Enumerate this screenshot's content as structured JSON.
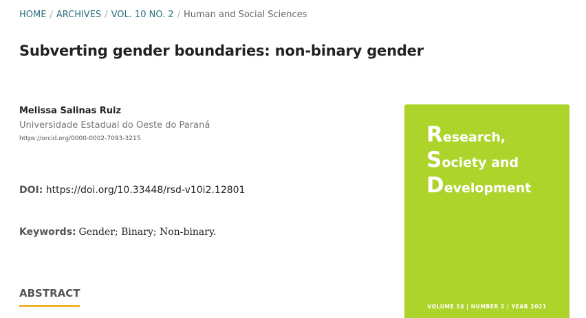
{
  "breadcrumb": {
    "home": "HOME",
    "archives": "ARCHIVES",
    "issue": "VOL. 10 NO. 2",
    "section": "Human and Social Sciences",
    "separator": "/"
  },
  "article": {
    "title": "Subverting gender boundaries: non-binary gender"
  },
  "author": {
    "name": "Melissa Salinas Ruiz",
    "affiliation": "Universidade Estadual do Oeste do Paraná",
    "orcid": "https://orcid.org/0000-0002-7093-3215"
  },
  "doi": {
    "label": "DOI:",
    "value": "https://doi.org/10.33448/rsd-v10i2.12801"
  },
  "keywords": {
    "label": "Keywords:",
    "value": "Gender; Binary; Non-binary."
  },
  "abstract": {
    "heading": "ABSTRACT"
  },
  "cover": {
    "line1_initial": "R",
    "line1_rest": "esearch,",
    "line2_initial": "S",
    "line2_rest": "ociety and",
    "line3_initial": "D",
    "line3_rest": "evelopment",
    "footer": "VOLUME 10 | NUMBER 2 | YEAR 2021",
    "background_color": "#add42a"
  },
  "colors": {
    "link": "#2a6e7f",
    "accent_underline": "#f0b429"
  }
}
